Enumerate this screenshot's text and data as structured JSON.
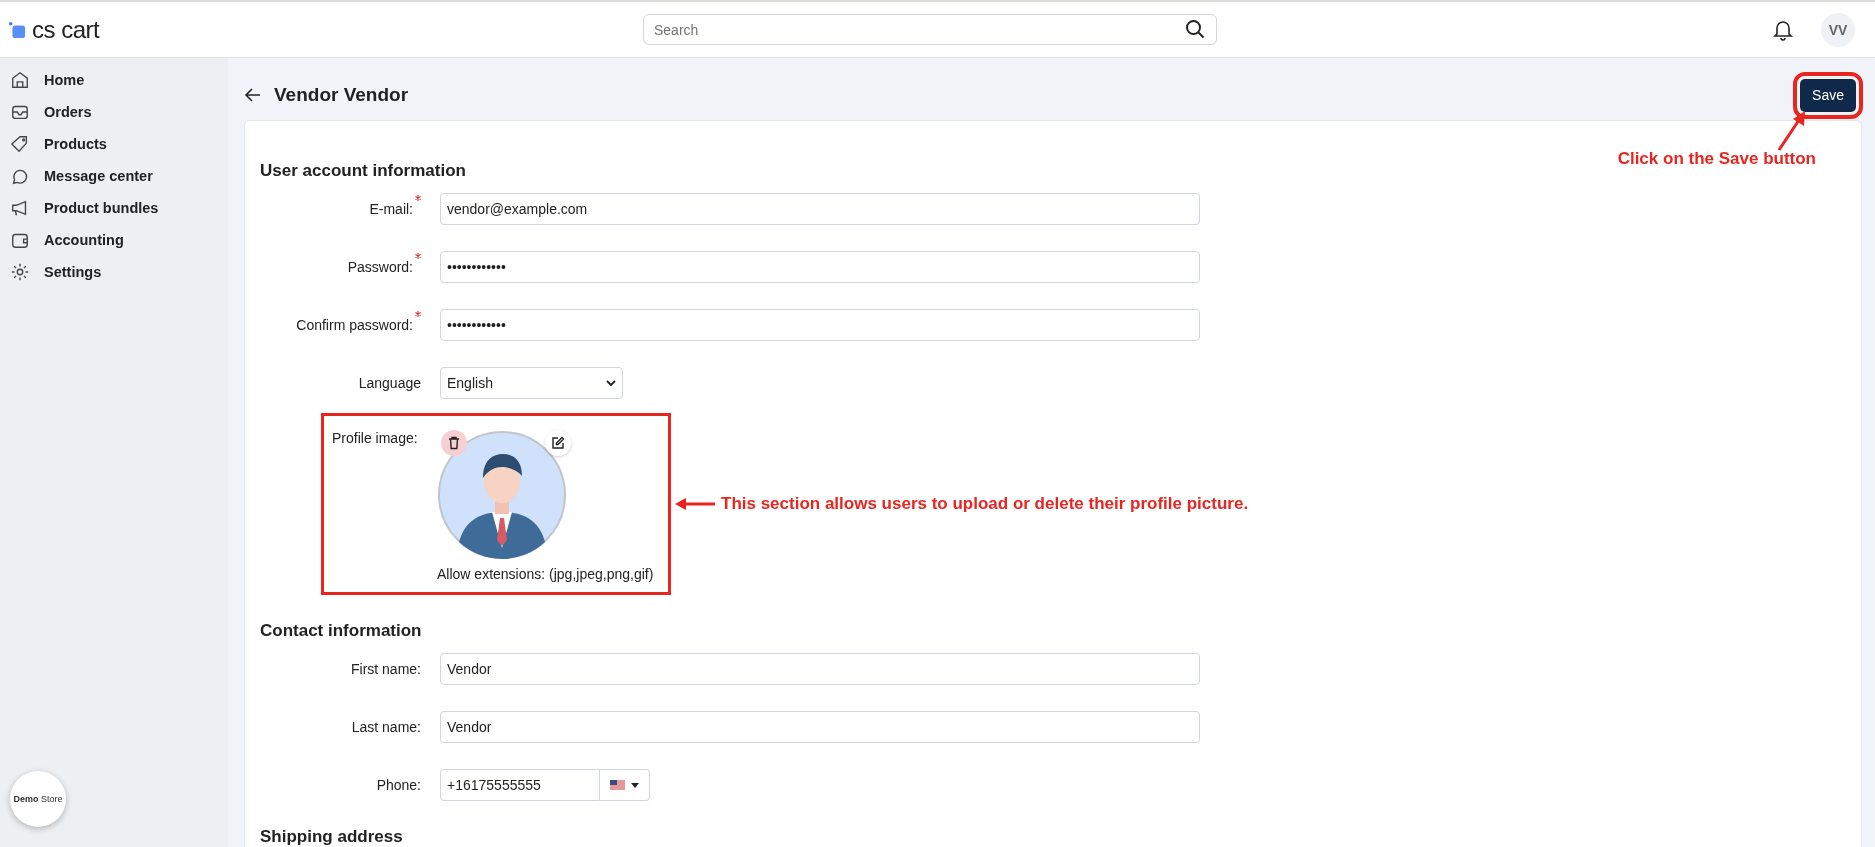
{
  "header": {
    "logo": "cs cart",
    "search": {
      "placeholder": "Search"
    },
    "avatar_initials": "VV"
  },
  "sidebar": {
    "items": [
      {
        "label": "Home"
      },
      {
        "label": "Orders"
      },
      {
        "label": "Products"
      },
      {
        "label": "Message center"
      },
      {
        "label": "Product bundles"
      },
      {
        "label": "Accounting"
      },
      {
        "label": "Settings"
      }
    ],
    "store_badge": "**Demo** Store"
  },
  "page": {
    "title": "Vendor Vendor",
    "save_button": "Save"
  },
  "sections": [
    {
      "title": "User account information",
      "fields": [
        {
          "kind": "text",
          "label": "E-mail:",
          "required": true,
          "value": "vendor@example.com"
        },
        {
          "kind": "text",
          "label": "Password:",
          "required": true,
          "value": "••••••••••••"
        },
        {
          "kind": "text",
          "label": "Confirm password:",
          "required": true,
          "value": "••••••••••••"
        },
        {
          "kind": "select",
          "label": "Language",
          "required": false,
          "value": "English"
        },
        {
          "kind": "image",
          "label": "Profile image:",
          "note": "Allow extensions: (jpg,jpeg,png,gif)"
        }
      ]
    },
    {
      "title": "Contact information",
      "fields": [
        {
          "kind": "text",
          "label": "First name:",
          "required": false,
          "value": "Vendor"
        },
        {
          "kind": "text",
          "label": "Last name:",
          "required": false,
          "value": "Vendor"
        },
        {
          "kind": "phone",
          "label": "Phone:",
          "required": false,
          "value": "+16175555555"
        }
      ]
    },
    {
      "title": "Shipping address"
    }
  ],
  "annotations": [
    {
      "text": "Click on the Save button"
    },
    {
      "text": "This section allows users to upload or delete their profile picture."
    }
  ]
}
